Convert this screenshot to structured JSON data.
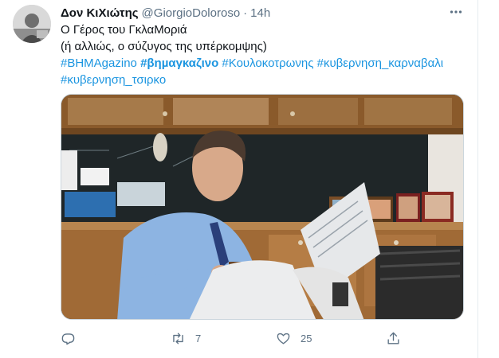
{
  "tweet": {
    "display_name": "Δον ΚιΧιώτης",
    "handle": "@GiorgioDoloroso",
    "separator": "·",
    "time": "14h",
    "more_icon": "more-horizontal-icon",
    "text_line1": "Ο Γέρος του ΓκλαΜοριά",
    "text_line2": "(ή αλλιώς, ο σύζυγος της υπέρκομψης)",
    "hashtags": [
      "#BHMAgazino",
      "#βηµαγκαζινο",
      "#Κουλοκοτρωνης",
      "#κυβερνηση_καρναβαλι",
      "#κυβερνηση_τσιρκο"
    ],
    "actions": {
      "reply_icon": "reply-icon",
      "retweet_icon": "retweet-icon",
      "retweet_count": "7",
      "like_icon": "heart-icon",
      "like_count": "25",
      "share_icon": "share-icon"
    }
  },
  "colors": {
    "link": "#1b95e0",
    "muted": "#5b7083",
    "text": "#0f1419"
  }
}
